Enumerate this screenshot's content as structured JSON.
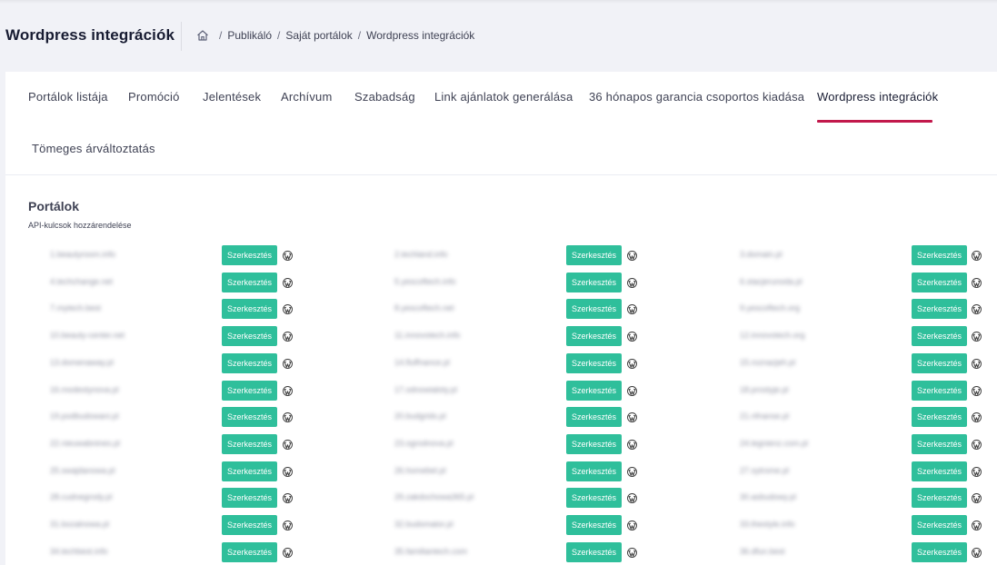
{
  "header": {
    "title": "Wordpress integrációk",
    "breadcrumb": [
      "Publikáló",
      "Saját portálok",
      "Wordpress integrációk"
    ]
  },
  "tabs": [
    {
      "label": "Portálok listája",
      "active": false
    },
    {
      "label": "Promóció",
      "active": false
    },
    {
      "label": "Jelentések",
      "active": false
    },
    {
      "label": "Archívum",
      "active": false
    },
    {
      "label": "Szabadság",
      "active": false
    },
    {
      "label": "Link ajánlatok generálása",
      "active": false
    },
    {
      "label": "36 hónapos garancia csoportos kiadása",
      "active": false
    },
    {
      "label": "Wordpress integrációk",
      "active": true
    },
    {
      "label": "Tömeges árváltoztatás",
      "active": false
    }
  ],
  "section": {
    "title": "Portálok",
    "subtitle": "API-kulcsok hozzárendelése"
  },
  "edit_label": "Szerkesztés",
  "icons": {
    "home": "home-icon",
    "wordpress": "wordpress-icon"
  },
  "colors": {
    "accent": "#c2184b",
    "button": "#2fbf9b"
  },
  "portals": [
    "1.beautyroom.info",
    "2.techland.info",
    "3.domain.pl",
    "4.techchange.net",
    "5.yescoftech.info",
    "6.stacjerunoda.pl",
    "7.mytech.best",
    "8.yescoftech.net",
    "9.yescoftech.org",
    "10.beauty-center.net",
    "11.innovotech.info",
    "12.innovotech.org",
    "13.domenaway.pl",
    "14.fluffnance.pl",
    "15.roznazjeh.pl",
    "16.modestynova.pl",
    "17.odnowialoty.pl",
    "18.prostyje.pl",
    "19.podbudowani.pl",
    "20.budgrids.pl",
    "21.nfnanse.pl",
    "22.nieuwabnines.pl",
    "23.ogrodnova.pl",
    "24.legnienz.com.pl",
    "25.swajdanowa.pl",
    "26.homebel.pl",
    "27.sytrome.pl",
    "28.cudnegrody.pl",
    "29.zakdochowa365.pl",
    "30.asbudowy.pl",
    "31.bozalnowa.pl",
    "32.budomator.pl",
    "33.thestyle.info",
    "34.techbest.info",
    "35.familiantech.com",
    "36.dfun.best"
  ]
}
